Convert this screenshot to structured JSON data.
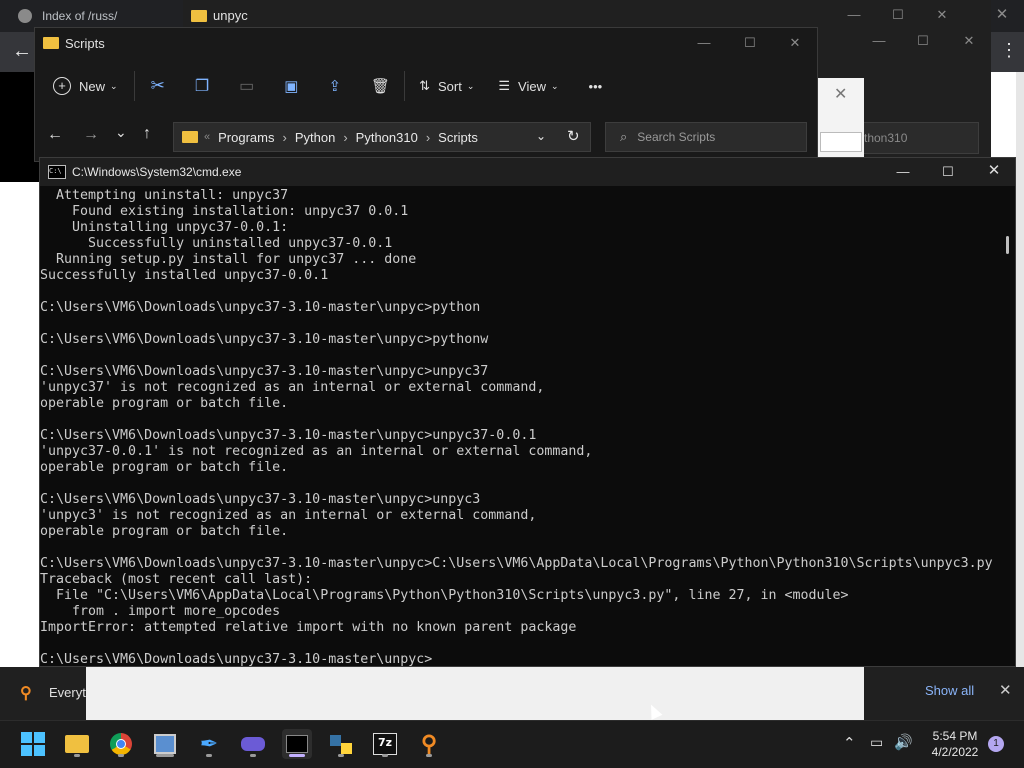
{
  "browser": {
    "tab_label": "Index of /russ/",
    "colors": {
      "bg": "#202124",
      "page": "#ffffff"
    }
  },
  "explorer_back": {
    "title": "unpyc",
    "search_fragment": "thon310"
  },
  "explorer": {
    "title": "Scripts",
    "toolbar": {
      "new_label": "New",
      "sort_label": "Sort",
      "view_label": "View",
      "more_label": "•••"
    },
    "breadcrumb": [
      "Programs",
      "Python",
      "Python310",
      "Scripts"
    ],
    "search_placeholder": "Search Scripts"
  },
  "cmd": {
    "title": "C:\\Windows\\System32\\cmd.exe",
    "lines": [
      "  Attempting uninstall: unpyc37",
      "    Found existing installation: unpyc37 0.0.1",
      "    Uninstalling unpyc37-0.0.1:",
      "      Successfully uninstalled unpyc37-0.0.1",
      "  Running setup.py install for unpyc37 ... done",
      "Successfully installed unpyc37-0.0.1",
      "",
      "C:\\Users\\VM6\\Downloads\\unpyc37-3.10-master\\unpyc>python",
      "",
      "C:\\Users\\VM6\\Downloads\\unpyc37-3.10-master\\unpyc>pythonw",
      "",
      "C:\\Users\\VM6\\Downloads\\unpyc37-3.10-master\\unpyc>unpyc37",
      "'unpyc37' is not recognized as an internal or external command,",
      "operable program or batch file.",
      "",
      "C:\\Users\\VM6\\Downloads\\unpyc37-3.10-master\\unpyc>unpyc37-0.0.1",
      "'unpyc37-0.0.1' is not recognized as an internal or external command,",
      "operable program or batch file.",
      "",
      "C:\\Users\\VM6\\Downloads\\unpyc37-3.10-master\\unpyc>unpyc3",
      "'unpyc3' is not recognized as an internal or external command,",
      "operable program or batch file.",
      "",
      "C:\\Users\\VM6\\Downloads\\unpyc37-3.10-master\\unpyc>C:\\Users\\VM6\\AppData\\Local\\Programs\\Python\\Python310\\Scripts\\unpyc3.py",
      "Traceback (most recent call last):",
      "  File \"C:\\Users\\VM6\\AppData\\Local\\Programs\\Python\\Python310\\Scripts\\unpyc3.py\", line 27, in <module>",
      "    from . import more_opcodes",
      "ImportError: attempted relative import with no known parent package",
      "",
      "C:\\Users\\VM6\\Downloads\\unpyc37-3.10-master\\unpyc>"
    ]
  },
  "search_bar": {
    "text": "Everyth",
    "show_all_label": "Show all"
  },
  "taskbar": {
    "time": "5:54 PM",
    "date": "4/2/2022",
    "notification_count": "1",
    "apps": [
      "windows-start",
      "file-explorer",
      "chrome",
      "control-panel",
      "pen-app",
      "vr-app",
      "terminal",
      "python",
      "7zip",
      "everything-search"
    ]
  },
  "colors": {
    "accent": "#0078d4",
    "console_bg": "#0c0c0c",
    "console_text": "#cccccc",
    "badge": "#b4a7f0"
  }
}
